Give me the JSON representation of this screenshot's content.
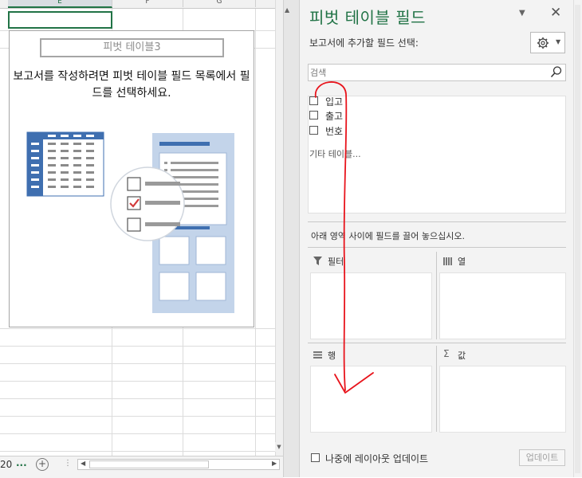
{
  "sheet": {
    "columns": [
      "E",
      "F",
      "G"
    ],
    "pivot_name": "피벗 테이블3",
    "instructions": "보고서를 작성하려면 피벗 테이블 필드 목록에서 필드를 선택하세요.",
    "sheet_tab_partial": "20",
    "ellipsis": "...",
    "add_sheet": "+"
  },
  "pane": {
    "title": "피벗 테이블 필드",
    "choose_fields_label": "보고서에 추가할 필드 선택:",
    "search_placeholder": "검색",
    "fields": [
      {
        "label": "입고",
        "checked": false
      },
      {
        "label": "출고",
        "checked": false
      },
      {
        "label": "번호",
        "checked": false
      }
    ],
    "more_tables": "기타 테이블...",
    "drag_hint": "아래 영역 사이에 필드를 끌어 놓으십시오.",
    "areas": {
      "filters": "필터",
      "columns": "열",
      "rows": "행",
      "values": "값"
    },
    "defer_update_label": "나중에 레이아웃 업데이트",
    "update_button": "업데이트"
  },
  "colors": {
    "accent_green": "#217346",
    "illustration_blue": "#3f6fb0",
    "annotation_red": "#e8141c"
  },
  "icons": [
    "dropdown-arrow-icon",
    "close-icon",
    "gear-icon",
    "search-icon",
    "filter-icon",
    "columns-icon",
    "rows-icon",
    "sigma-icon",
    "plus-icon"
  ]
}
